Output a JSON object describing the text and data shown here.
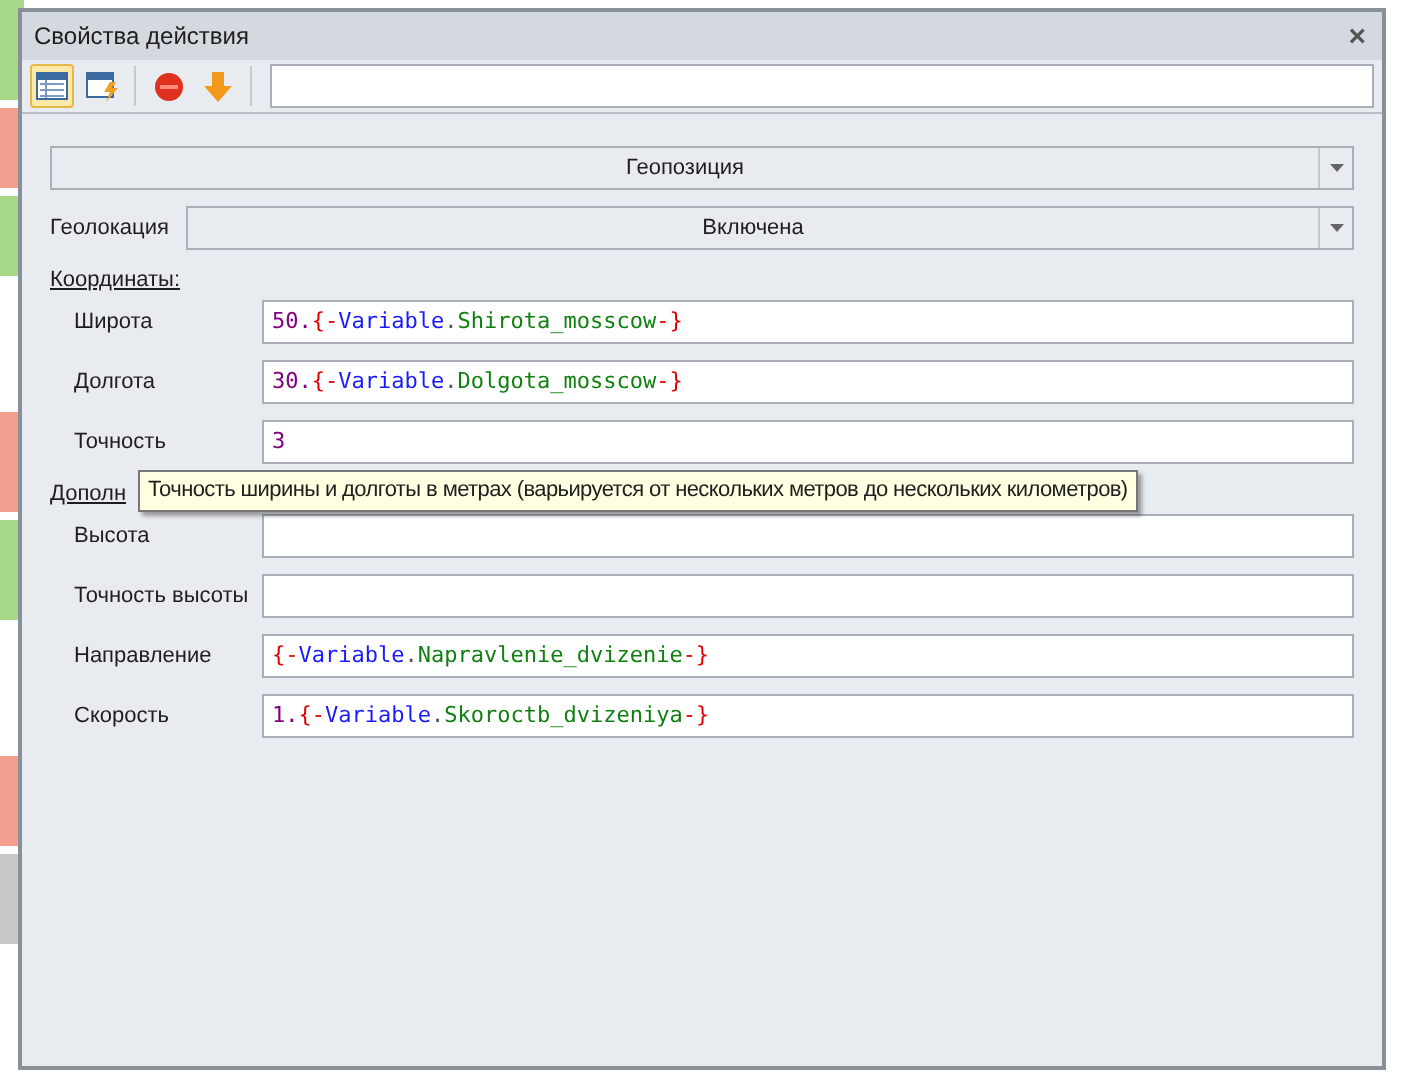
{
  "window": {
    "title": "Свойства действия",
    "close": "×"
  },
  "toolbar": {
    "buttons": [
      {
        "kind": "grid",
        "selected": true
      },
      {
        "kind": "flash",
        "selected": false
      },
      {
        "kind": "stop",
        "selected": false
      },
      {
        "kind": "down",
        "selected": false
      }
    ]
  },
  "action_select": {
    "value": "Геопозиция"
  },
  "geolocation": {
    "label": "Геолокация",
    "value": "Включена"
  },
  "sections": [
    {
      "title": "Координаты:",
      "fields": [
        {
          "label": "Широта",
          "tokens": [
            {
              "kind": "num",
              "text": "50."
            },
            {
              "kind": "brace",
              "text": "{-"
            },
            {
              "kind": "kw",
              "text": "Variable"
            },
            {
              "kind": "dot",
              "text": "."
            },
            {
              "kind": "name",
              "text": "Shirota_mosscow"
            },
            {
              "kind": "brace",
              "text": "-}"
            }
          ]
        },
        {
          "label": "Долгота",
          "tokens": [
            {
              "kind": "num",
              "text": "30."
            },
            {
              "kind": "brace",
              "text": "{-"
            },
            {
              "kind": "kw",
              "text": "Variable"
            },
            {
              "kind": "dot",
              "text": "."
            },
            {
              "kind": "name",
              "text": "Dolgota_mosscow"
            },
            {
              "kind": "brace",
              "text": "-}"
            }
          ]
        },
        {
          "label": "Точность",
          "tokens": [
            {
              "kind": "num",
              "text": "3"
            }
          ]
        }
      ]
    },
    {
      "title": "Дополн",
      "fields": [
        {
          "label": "Высота"
        },
        {
          "label": "Точность высоты"
        },
        {
          "label": "Направление",
          "tokens": [
            {
              "kind": "brace",
              "text": "{-"
            },
            {
              "kind": "kw",
              "text": "Variable"
            },
            {
              "kind": "dot",
              "text": "."
            },
            {
              "kind": "name",
              "text": "Napravlenie_dvizenie"
            },
            {
              "kind": "brace",
              "text": "-}"
            }
          ]
        },
        {
          "label": "Скорость",
          "tokens": [
            {
              "kind": "num",
              "text": "1."
            },
            {
              "kind": "brace",
              "text": "{-"
            },
            {
              "kind": "kw",
              "text": "Variable"
            },
            {
              "kind": "dot",
              "text": "."
            },
            {
              "kind": "name",
              "text": "Skoroctb_dvizeniya"
            },
            {
              "kind": "brace",
              "text": "-}"
            }
          ]
        }
      ]
    }
  ],
  "tooltip": "Точность ширины и долготы в метрах (варьируется от нескольких метров до нескольких километров)"
}
